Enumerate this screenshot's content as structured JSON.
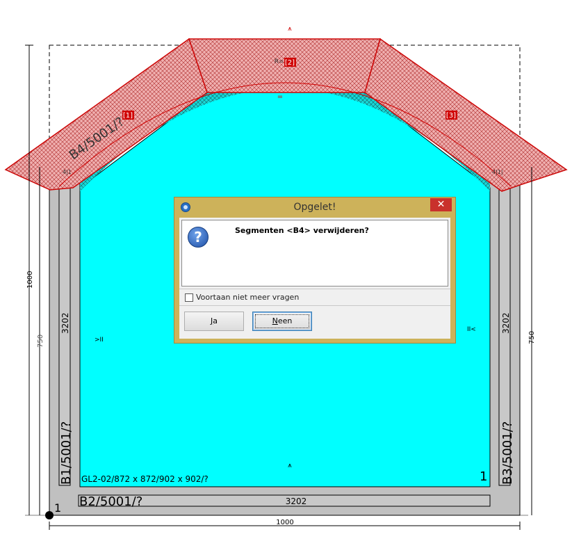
{
  "drawing": {
    "top_dim_mark": "⩚",
    "top_label": "R=?",
    "segment_1": "[1]",
    "segment_2": "[2]",
    "segment_3": "[3]",
    "beam_b4": "B4/5001/?",
    "beam_b1": "B1/5001/?",
    "beam_b3": "B3/5001/?",
    "beam_b2": "B2/5001/?",
    "left_height_label": "3202",
    "right_height_label": "3202",
    "bottom_length_label": "3202",
    "glass_label": "GL2-02/872 x 872/902 x 902/?",
    "corner_left_number": "1",
    "corner_right_number": "1",
    "left_corner_mark": "4|1",
    "right_corner_mark": "4|1|",
    "left_marker": ">II",
    "right_marker": "II<",
    "bottom_center_marker": "⩚",
    "left_dim_outer": "1000",
    "left_dim_inner": "750",
    "right_dim": "750",
    "bottom_dim": "1000",
    "colors": {
      "glass": "#00ffff",
      "frame": "#c0c0c0",
      "selected_hatch": "#e8a0a0",
      "selected_outline": "#e00000"
    }
  },
  "dialog": {
    "title": "Opgelet!",
    "close_glyph": "✕",
    "message": "Segmenten <B4> verwijderen?",
    "checkbox_label": "Voortaan niet meer vragen",
    "checkbox_checked": false,
    "yes_button_accel": "J",
    "yes_button_rest": "a",
    "no_button_accel": "N",
    "no_button_rest": "een",
    "icon": "question-icon"
  }
}
